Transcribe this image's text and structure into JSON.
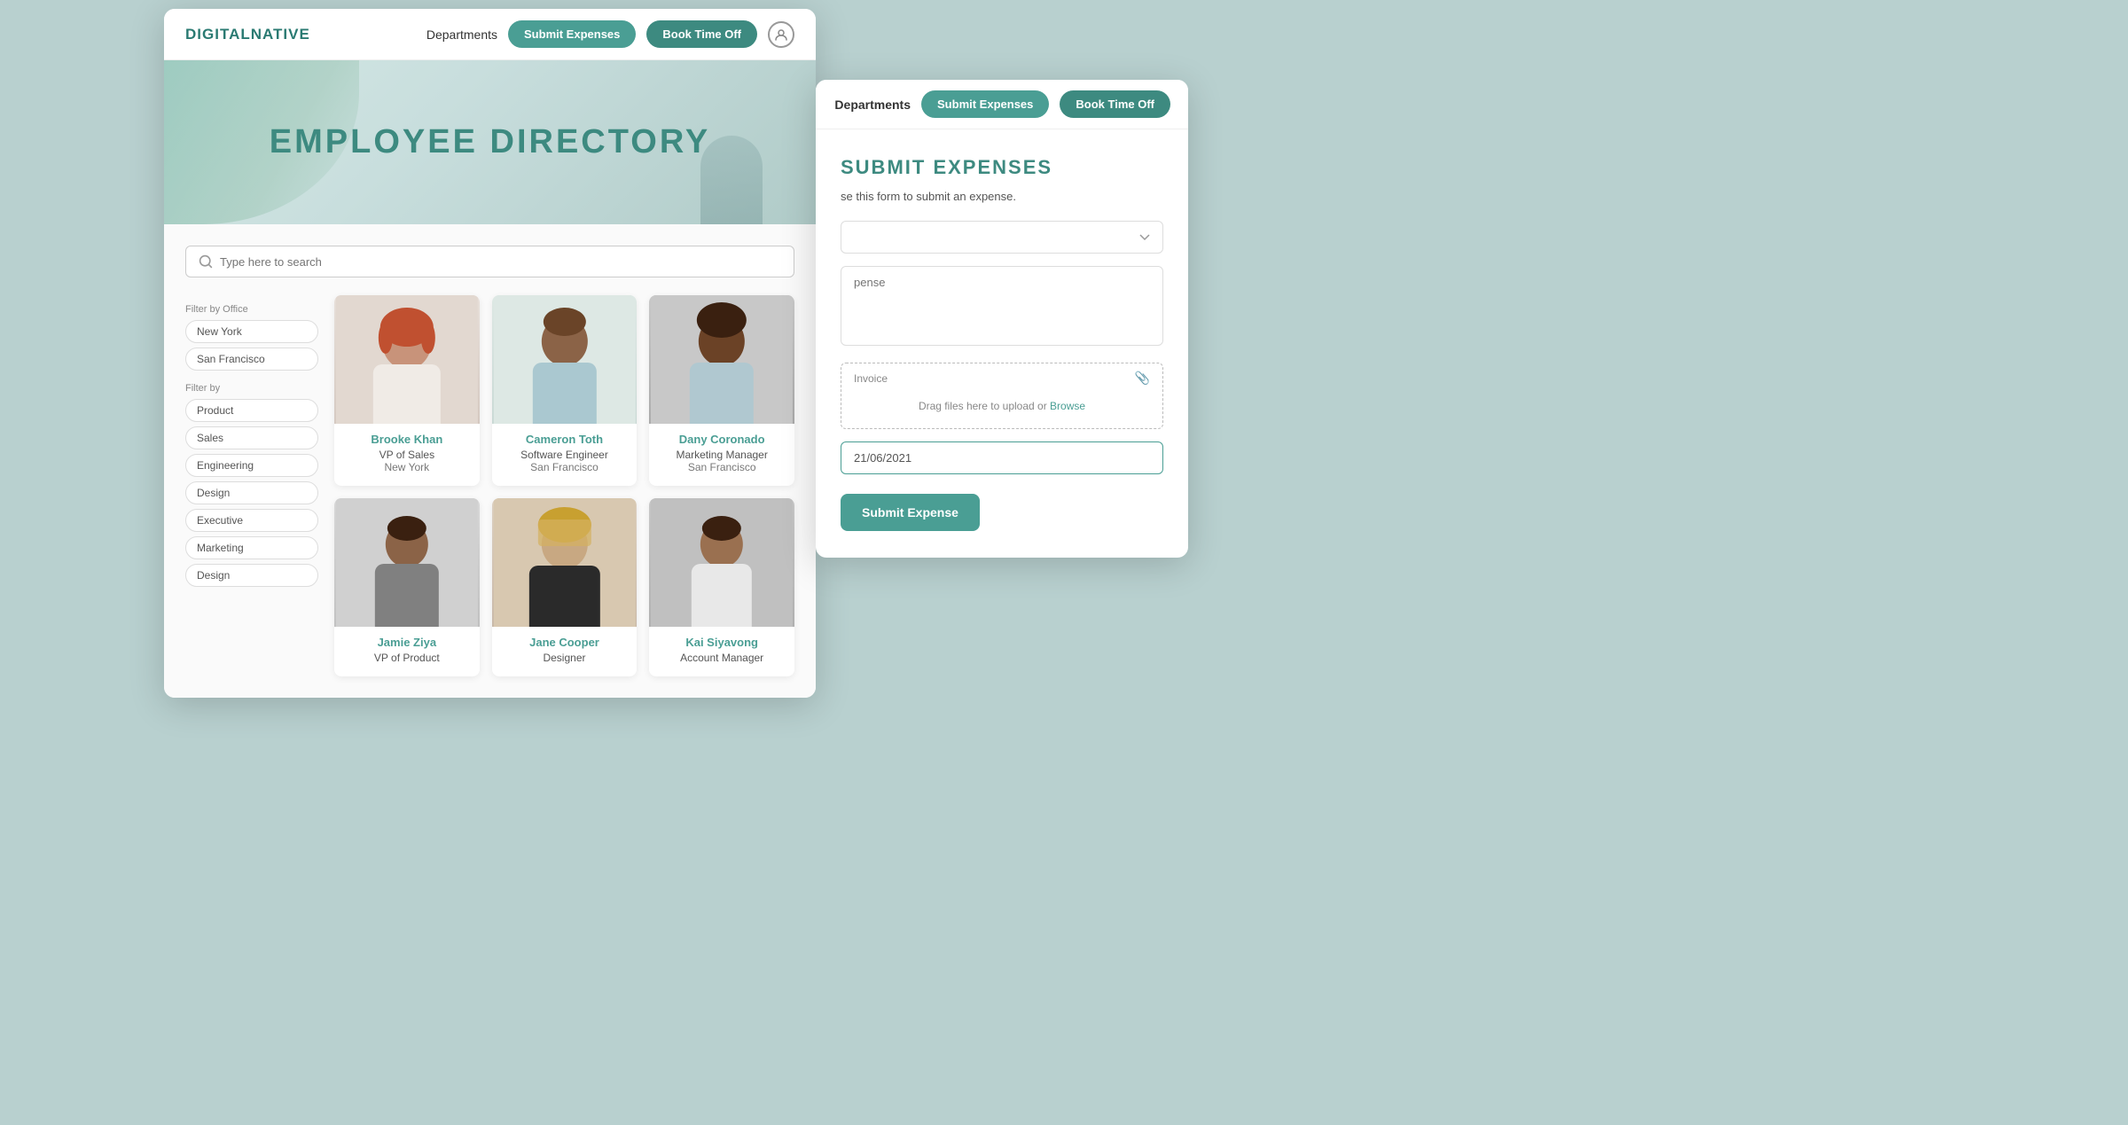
{
  "background_color": "#b8d0cf",
  "main_window": {
    "logo": "DIGITALNATIVE",
    "nav": {
      "departments_label": "Departments",
      "submit_expenses_label": "Submit Expenses",
      "book_time_off_label": "Book Time Off"
    },
    "hero": {
      "title": "EMPLOYEE DIRECTORY"
    },
    "search": {
      "placeholder": "Type here to search"
    },
    "filters": {
      "office_label": "Filter by Office",
      "office_options": [
        "New York",
        "San Francisco"
      ],
      "dept_label": "Filter by",
      "dept_options": [
        "Product",
        "Sales",
        "Engineering",
        "Design",
        "Executive",
        "Marketing",
        "Design"
      ]
    },
    "employees": [
      {
        "name": "Brooke Khan",
        "role": "VP of Sales",
        "office": "New York",
        "bg": "brooke"
      },
      {
        "name": "Cameron Toth",
        "role": "Software Engineer",
        "office": "San Francisco",
        "bg": "cameron"
      },
      {
        "name": "Dany Coronado",
        "role": "Marketing Manager",
        "office": "San Francisco",
        "bg": "dany"
      },
      {
        "name": "Jamie Ziya",
        "role": "VP of Product",
        "office": "",
        "bg": "jamie"
      },
      {
        "name": "Jane Cooper",
        "role": "Designer",
        "office": "",
        "bg": "jane"
      },
      {
        "name": "Kai Siyavong",
        "role": "Account Manager",
        "office": "",
        "bg": "kai"
      }
    ]
  },
  "popup_window": {
    "nav": {
      "departments_label": "Departments",
      "submit_expenses_label": "Submit Expenses",
      "book_time_off_label": "Book Time Off"
    },
    "title": "SUBMIT EXPENSES",
    "subtitle": "se this form to submit an expense.",
    "form": {
      "category_placeholder": "",
      "description_placeholder": "pense",
      "invoice_label": "Invoice",
      "upload_text": "Drag files here to upload or",
      "upload_browse": "Browse",
      "date_label": ": 21/06/2021",
      "date_value": "21/06/2021",
      "submit_label": "Submit Expense"
    }
  }
}
